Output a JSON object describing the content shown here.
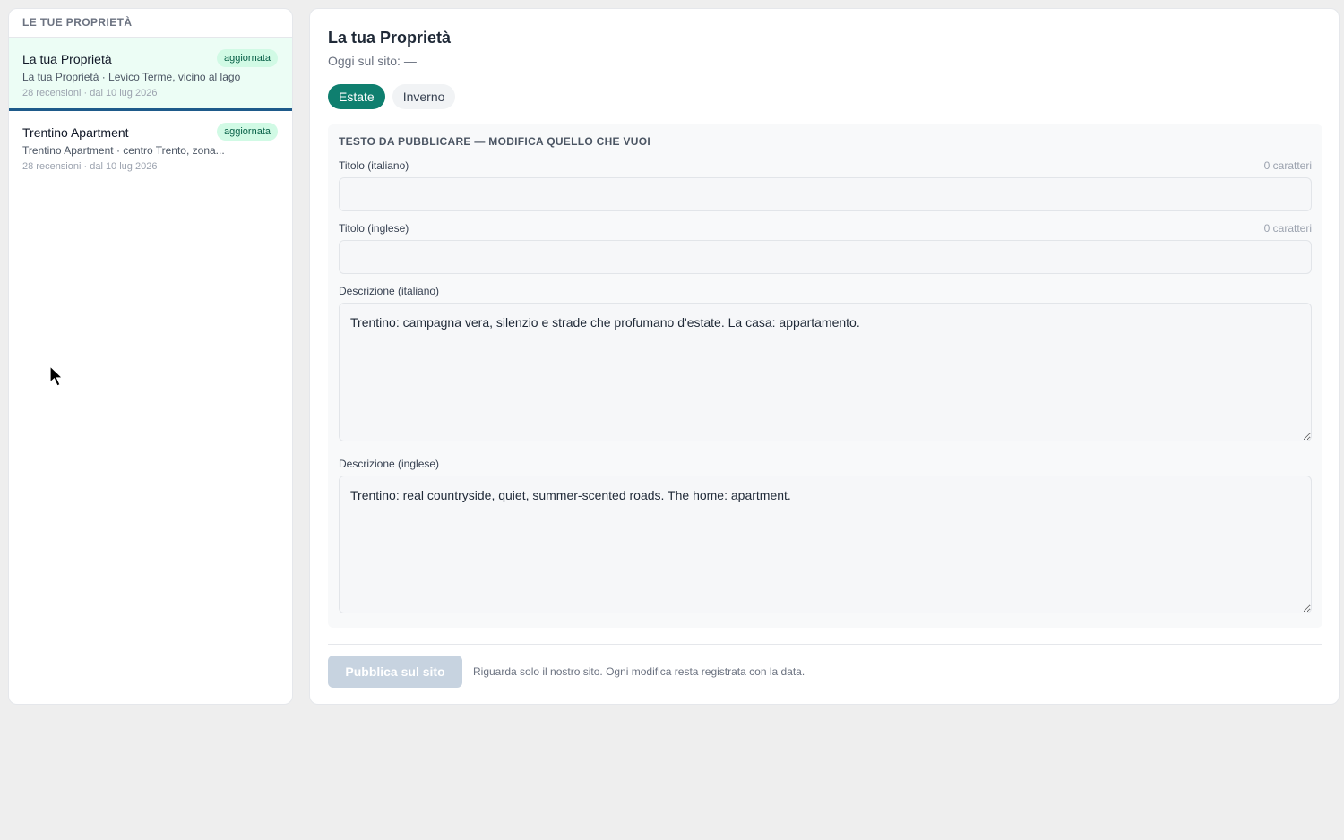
{
  "sidebar": {
    "header": "LE TUE PROPRIETÀ",
    "items": [
      {
        "name": "La tua Proprietà",
        "badge": "aggiornata",
        "subtitle": "La tua Proprietà · Levico Terme, vicino al lago",
        "meta": "28 recensioni · dal 10 lug 2026"
      },
      {
        "name": "Trentino Apartment",
        "badge": "aggiornata",
        "subtitle": "Trentino Apartment · centro Trento, zona...",
        "meta": "28 recensioni · dal 10 lug 2026"
      }
    ]
  },
  "main": {
    "title": "La tua Proprietà",
    "today": "Oggi sul sito: —",
    "tabs": [
      {
        "label": "Estate",
        "active": true
      },
      {
        "label": "Inverno",
        "active": false
      }
    ],
    "editor": {
      "heading": "TESTO DA PUBBLICARE — MODIFICA QUELLO CHE VUOI",
      "title_it": {
        "label": "Titolo (italiano)",
        "count": "0 caratteri",
        "value": ""
      },
      "title_en": {
        "label": "Titolo (inglese)",
        "count": "0 caratteri",
        "value": ""
      },
      "desc_it": {
        "label": "Descrizione (italiano)",
        "value": "Trentino: campagna vera, silenzio e strade che profumano d'estate. La casa: appartamento."
      },
      "desc_en": {
        "label": "Descrizione (inglese)",
        "value": "Trentino: real countryside, quiet, summer-scented roads. The home: apartment."
      }
    },
    "publish_label": "Pubblica sul sito",
    "publish_note": "Riguarda solo il nostro sito. Ogni modifica resta registrata con la data."
  },
  "colors": {
    "accent": "#0f7f6f",
    "active_item_bg": "#ecfdf5",
    "badge_bg": "#d1fae5",
    "disabled_button": "#c7d3e0"
  }
}
